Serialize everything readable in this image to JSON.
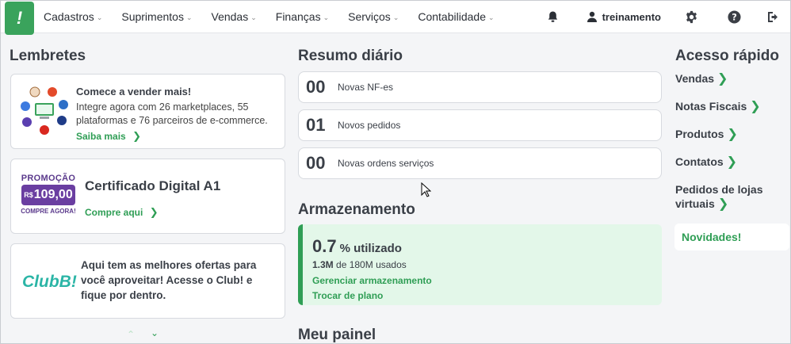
{
  "nav": {
    "logo": "!",
    "menu": [
      {
        "label": "Cadastros"
      },
      {
        "label": "Suprimentos"
      },
      {
        "label": "Vendas"
      },
      {
        "label": "Finanças"
      },
      {
        "label": "Serviços"
      },
      {
        "label": "Contabilidade"
      }
    ],
    "user": "treinamento"
  },
  "lembretes": {
    "title": "Lembretes",
    "card1": {
      "title": "Comece a vender mais!",
      "text": "Integre agora com 26 marketplaces, 55 plataformas e 76 parceiros de e-commerce.",
      "link": "Saiba mais"
    },
    "card2": {
      "promo_top": "PROMOÇÃO",
      "promo_currency": "R$",
      "promo_price": "109,00",
      "promo_bottom": "COMPRE AGORA!",
      "title": "Certificado Digital A1",
      "link": "Compre aqui"
    },
    "card3": {
      "logo": "ClubB!",
      "text": "Aqui tem as melhores ofertas para você aproveitar! Acesse o Club! e fique por dentro."
    }
  },
  "resumo": {
    "title": "Resumo diário",
    "rows": [
      {
        "num": "00",
        "label": "Novas NF-es"
      },
      {
        "num": "01",
        "label": "Novos pedidos"
      },
      {
        "num": "00",
        "label": "Novas ordens serviços"
      }
    ]
  },
  "armazenamento": {
    "title": "Armazenamento",
    "percent": "0.7",
    "percent_suffix": "% utilizado",
    "used": "1.3M",
    "used_suffix": "de 180M usados",
    "link1": "Gerenciar armazenamento",
    "link2": "Trocar de plano"
  },
  "meu_painel": {
    "title": "Meu painel"
  },
  "acesso": {
    "title": "Acesso rápido",
    "items": [
      {
        "label": "Vendas"
      },
      {
        "label": "Notas Fiscais"
      },
      {
        "label": "Produtos"
      },
      {
        "label": "Contatos"
      },
      {
        "label": "Pedidos de lojas virtuais"
      }
    ],
    "novidades": "Novidades!"
  },
  "colors": {
    "green": "#2f9e55",
    "storage_bg": "#e3f7e9",
    "storage_bar": "#2f9e55"
  }
}
